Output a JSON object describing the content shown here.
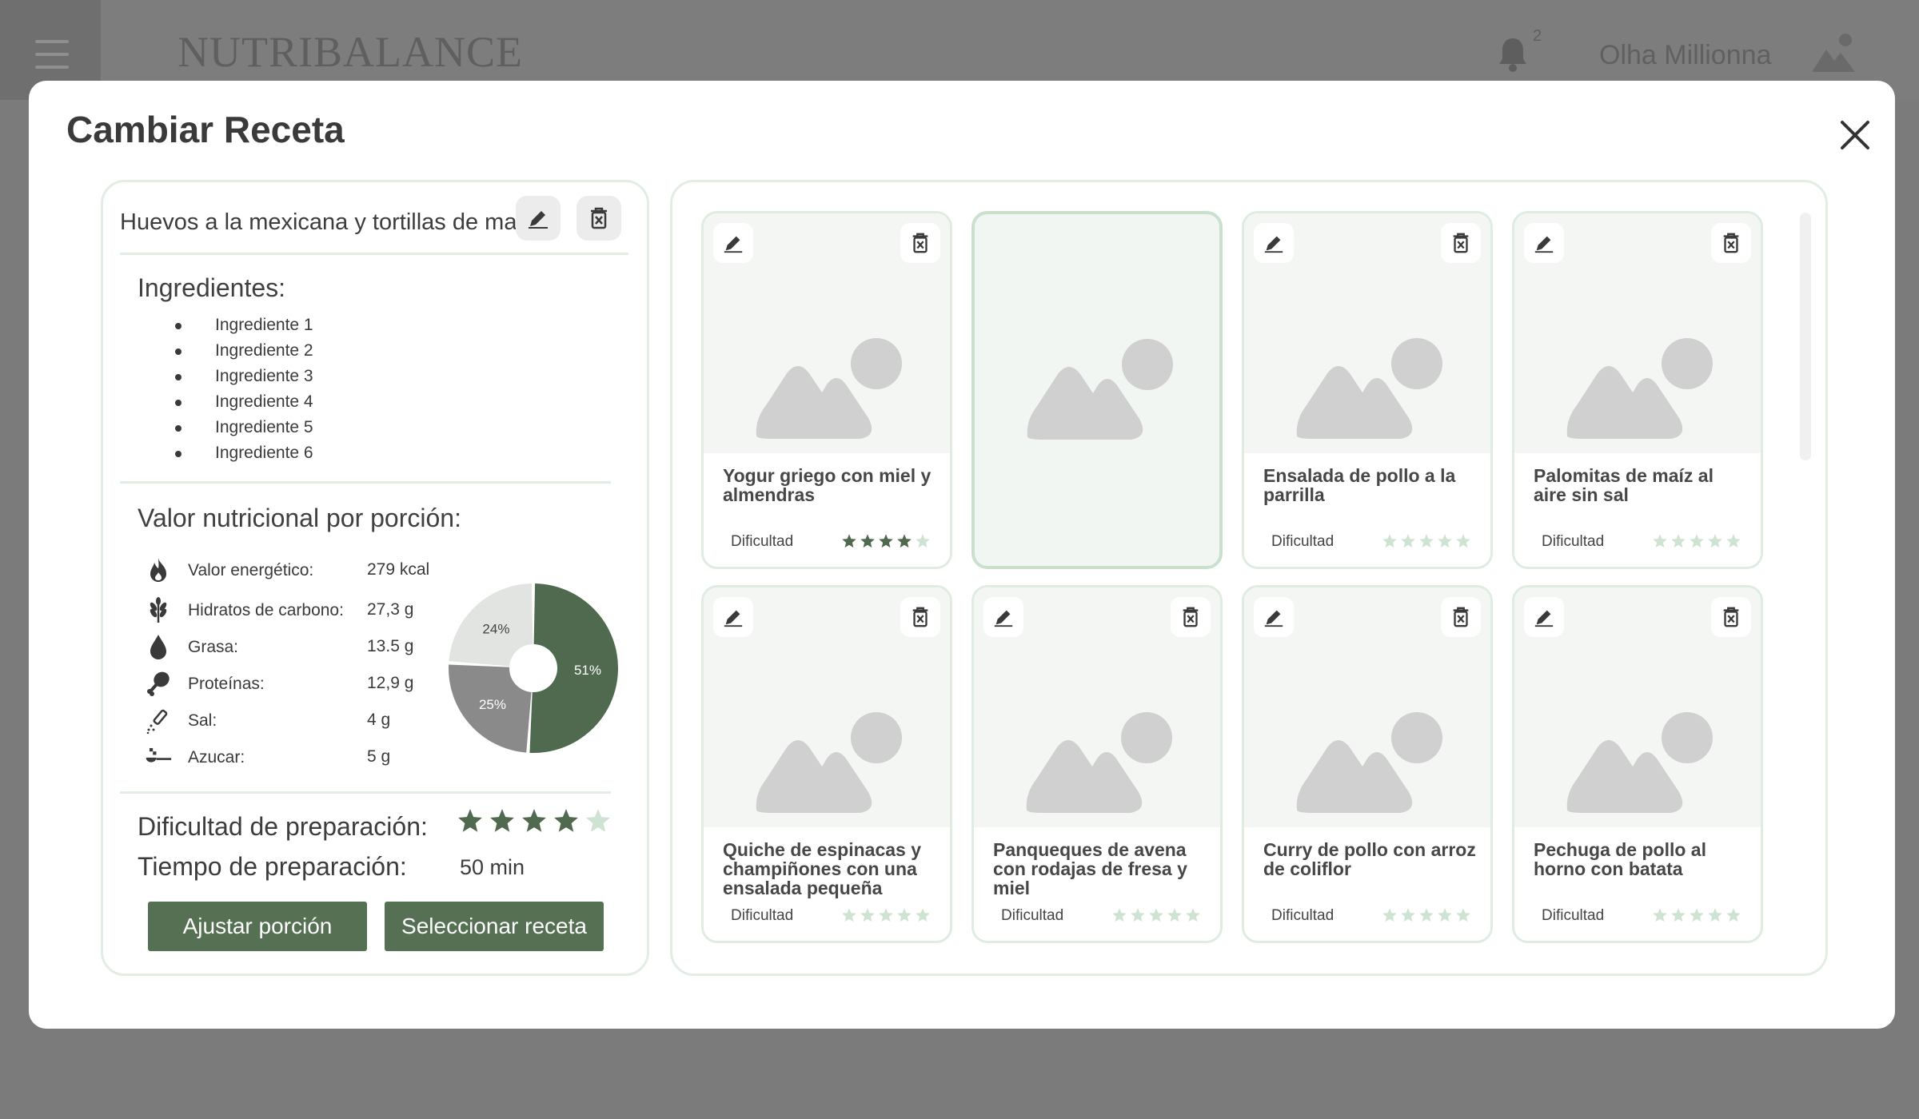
{
  "app": {
    "brand": "NUTRIBALANCE",
    "notification_count": "2",
    "user_name": "Olha Millionna"
  },
  "modal": {
    "title": "Cambiar Receta"
  },
  "current_recipe": {
    "title": "Huevos a la mexicana y tortillas de maíz",
    "ingredients_heading": "Ingredientes:",
    "ingredients": [
      "Ingrediente 1",
      "Ingrediente 2",
      "Ingrediente 3",
      "Ingrediente 4",
      "Ingrediente 5",
      "Ingrediente 6"
    ],
    "nutrition_heading": "Valor nutricional por porción:",
    "nutrition": [
      {
        "label": "Valor energético:",
        "value": "279 kcal",
        "icon": "flame-icon"
      },
      {
        "label": "Hidratos de carbono:",
        "value": "27,3 g",
        "icon": "wheat-icon"
      },
      {
        "label": "Grasa:",
        "value": "13.5 g",
        "icon": "drop-icon"
      },
      {
        "label": "Proteínas:",
        "value": "12,9 g",
        "icon": "drumstick-icon"
      },
      {
        "label": "Sal:",
        "value": "4 g",
        "icon": "salt-shaker-icon"
      },
      {
        "label": "Azucar:",
        "value": "5 g",
        "icon": "sugar-spoon-icon"
      }
    ],
    "difficulty_label": "Dificultad de preparación:",
    "difficulty_rating": 4,
    "time_label": "Tiempo de preparación:",
    "time_value": "50 min",
    "adjust_button": "Ajustar porción",
    "select_button": "Seleccionar receta"
  },
  "chart_data": {
    "type": "pie",
    "donut": true,
    "categories": [
      "",
      "",
      ""
    ],
    "values": [
      51,
      25,
      24
    ],
    "labels": [
      "51%",
      "25%",
      "24%"
    ],
    "colors": [
      "#4f6a4e",
      "#8a8a8a",
      "#e2e4e2"
    ]
  },
  "cards": [
    {
      "title": "Yogur griego con miel y almendras",
      "difficulty_label": "Dificultad",
      "rating": 4,
      "selected": false
    },
    {
      "title": "",
      "difficulty_label": "",
      "rating": 0,
      "selected": true
    },
    {
      "title": "Ensalada de pollo a la parrilla",
      "difficulty_label": "Dificultad",
      "rating": 0,
      "selected": false
    },
    {
      "title": "Palomitas de maíz al aire sin sal",
      "difficulty_label": "Dificultad",
      "rating": 0,
      "selected": false
    },
    {
      "title": "Quiche de espinacas y champiñones con una ensalada pequeña",
      "difficulty_label": "Dificultad",
      "rating": 0,
      "selected": false
    },
    {
      "title": "Panqueques de avena con rodajas de fresa y miel",
      "difficulty_label": "Dificultad",
      "rating": 0,
      "selected": false
    },
    {
      "title": "Curry de pollo con arroz de coliflor",
      "difficulty_label": "Dificultad",
      "rating": 0,
      "selected": false
    },
    {
      "title": "Pechuga de pollo al horno con batata",
      "difficulty_label": "Dificultad",
      "rating": 0,
      "selected": false
    }
  ],
  "colors": {
    "accent": "#567054",
    "star_filled": "#4f6a4e",
    "star_empty": "#cfe3d2"
  }
}
